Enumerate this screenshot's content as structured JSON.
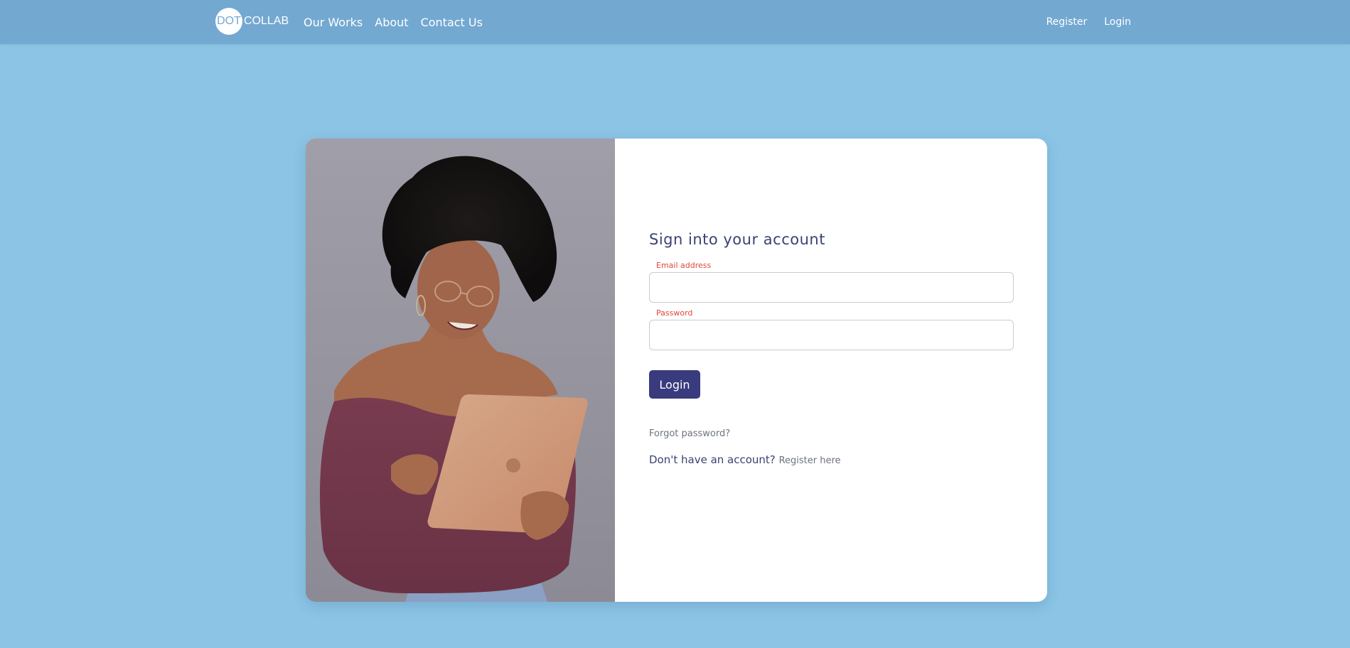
{
  "navbar": {
    "brand": {
      "circle_text": "DOT",
      "text": "COLLAB"
    },
    "links": [
      {
        "label": "Our Works"
      },
      {
        "label": "About"
      },
      {
        "label": "Contact Us"
      }
    ],
    "right_links": [
      {
        "label": "Register"
      },
      {
        "label": "Login"
      }
    ]
  },
  "login_form": {
    "title": "Sign into your account",
    "email": {
      "label": "Email address",
      "value": "",
      "placeholder": ""
    },
    "password": {
      "label": "Password",
      "value": "",
      "placeholder": ""
    },
    "submit_label": "Login",
    "forgot_password": "Forgot password?",
    "no_account_text": "Don't have an account?",
    "register_link": "Register here"
  },
  "colors": {
    "page_background": "#8bc4e5",
    "navbar": "#73a8d1",
    "button": "#393b7e",
    "heading": "#3b4274",
    "label_accent": "#e0473a"
  }
}
